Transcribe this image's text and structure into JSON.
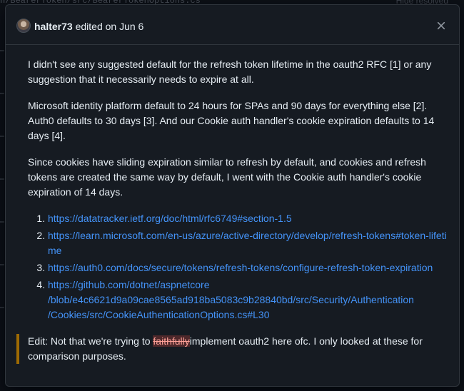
{
  "background": {
    "path_text": "n/BearerToken/src/BearerTokenOptions.cs",
    "right_text": "Hide resolved"
  },
  "dialog": {
    "author": "halter73",
    "edited_text": " edited on Jun 6",
    "close_icon": "close-icon"
  },
  "body": {
    "para1": "I didn't see any suggested default for the refresh token lifetime in the oauth2 RFC [1] or any suggestion that it necessarily needs to expire at all.",
    "para2": "Microsoft identity platform default to 24 hours for SPAs and 90 days for everything else [2]. Auth0 defaults to 30 days [3]. And our Cookie auth handler's cookie expiration defaults to 14 days [4].",
    "para3": "Since cookies have sliding expiration similar to refresh by default, and cookies and refresh tokens are created the same way by default, I went with the Cookie auth handler's cookie expiration of 14 days.",
    "links": [
      "https://datatracker.ietf.org/doc/html/rfc6749#section-1.5",
      "https://learn.microsoft.com/en-us/azure/active-directory/develop/refresh-tokens#token-lifetime",
      "https://auth0.com/docs/secure/tokens/refresh-tokens/configure-refresh-token-expiration",
      "https://github.com/dotnet/aspnetcore/blob/e4c6621d9a09cae8565ad918ba5083c9b28840bd/src/Security/Authentication/Cookies/src/CookieAuthenticationOptions.cs#L30"
    ],
    "link4_display": [
      "https://github.com/dotnet/aspnetcore",
      "/blob/e4c6621d9a09cae8565ad918ba5083c9b28840bd/src/Security/Authentication",
      "/Cookies/src/CookieAuthenticationOptions.cs#L30"
    ],
    "edit_prefix": "Edit: Not that we're trying to ",
    "edit_struck": "faithfully",
    "edit_suffix": "implement oauth2 here ofc. I only looked at these for comparison purposes."
  },
  "colors": {
    "link": "#4493f8",
    "quote_border": "#9e6a03",
    "dialog_bg": "#161b22"
  }
}
